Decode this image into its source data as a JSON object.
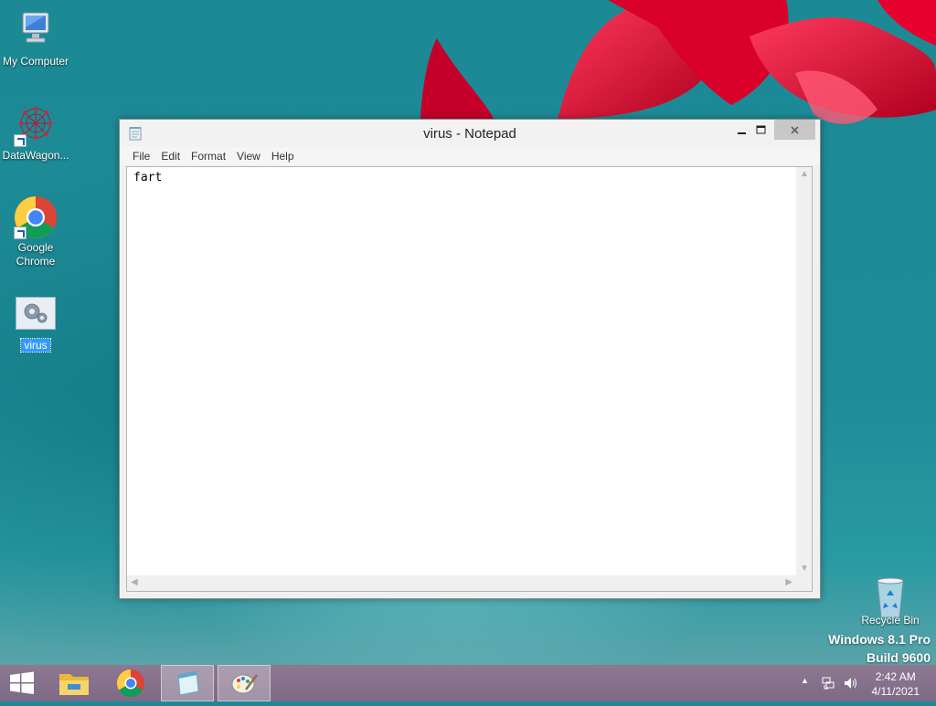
{
  "desktop": {
    "icons": [
      {
        "label": "My Computer",
        "icon": "computer-icon"
      },
      {
        "label": "DataWagon...",
        "icon": "datawagon-icon"
      },
      {
        "label": "Google Chrome",
        "icon": "chrome-icon"
      },
      {
        "label": "virus",
        "icon": "settings-file-icon",
        "selected": true
      },
      {
        "label": "Recycle Bin",
        "icon": "recycle-bin-icon"
      }
    ],
    "watermark": {
      "line1": "Windows 8.1 Pro",
      "line2": "Build 9600"
    }
  },
  "notepad": {
    "title": "virus - Notepad",
    "menu": [
      "File",
      "Edit",
      "Format",
      "View",
      "Help"
    ],
    "content": "fart"
  },
  "taskbar": {
    "buttons": [
      "start-button",
      "file-explorer-icon",
      "chrome-icon",
      "notepad-icon",
      "paint-icon"
    ],
    "clock": {
      "time": "2:42 AM",
      "date": "4/11/2021"
    }
  },
  "colors": {
    "desktop_bg": "#1e8c97",
    "taskbar_bg": "#8e7892",
    "selection": "#3399ff",
    "flower": "#e0103a"
  }
}
